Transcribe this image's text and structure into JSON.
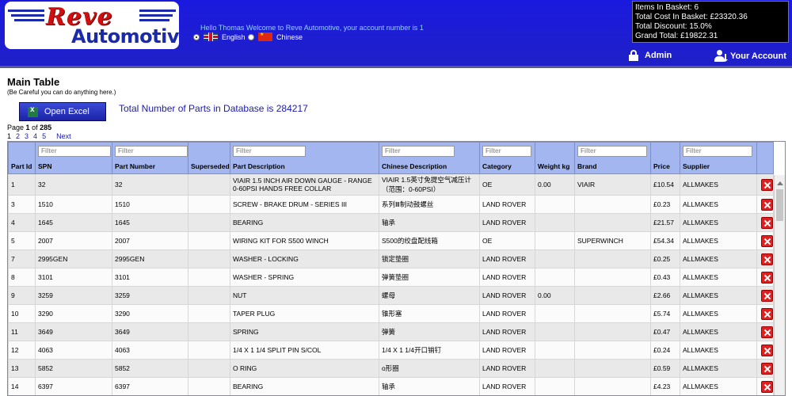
{
  "brand": {
    "line1": "Reve",
    "line2": "Automotive"
  },
  "header": {
    "welcome": "Hello Thomas Welcome to Reve Automotive, your account number is 1",
    "languages": [
      {
        "label": "English",
        "selected": true
      },
      {
        "label": "Chinese",
        "selected": false
      }
    ],
    "basket": {
      "items": "Items In Basket: 6",
      "cost": "Total Cost In Basket: £23320.36",
      "discount": "Total Discount: 15.0%",
      "grand": "Grand Total: £19822.31"
    },
    "admin_label": "Admin",
    "account_label": "Your Account"
  },
  "main": {
    "title": "Main Table",
    "warning": "(Be Careful you can do anything here.)",
    "excel_label": "Open Excel",
    "total_parts": "Total Number of Parts in Database is 284217",
    "page_word": "Page",
    "page_current": "1",
    "page_of": "of",
    "page_total": "285",
    "pages": [
      "1",
      "2",
      "3",
      "4",
      "5"
    ],
    "next": "Next"
  },
  "table": {
    "filter_placeholder": "Filter",
    "columns": [
      "Part Id",
      "SPN",
      "Part Number",
      "Superseded",
      "Part Description",
      "Chinese Description",
      "Category",
      "Weight kg",
      "Brand",
      "Price",
      "Supplier"
    ],
    "rows": [
      [
        "1",
        "32",
        "32",
        "",
        "VIAIR 1.5 INCH AIR DOWN GAUGE - RANGE 0-60PSI HANDS FREE COLLAR",
        "VIAIR 1.5英寸免提空气减压计（范围：0-60PSI）",
        "OE",
        "0.00",
        "VIAIR",
        "£10.54",
        "ALLMAKES"
      ],
      [
        "3",
        "1510",
        "1510",
        "",
        "SCREW - BRAKE DRUM - SERIES III",
        "系列Ⅲ制动鼓螺丝",
        "LAND ROVER",
        "",
        "",
        "£0.23",
        "ALLMAKES"
      ],
      [
        "4",
        "1645",
        "1645",
        "",
        "BEARING",
        "轴承",
        "LAND ROVER",
        "",
        "",
        "£21.57",
        "ALLMAKES"
      ],
      [
        "5",
        "2007",
        "2007",
        "",
        "WIRING KIT FOR S500 WINCH",
        "S500的绞盘配线箱",
        "OE",
        "",
        "SUPERWINCH",
        "£54.34",
        "ALLMAKES"
      ],
      [
        "7",
        "2995GEN",
        "2995GEN",
        "",
        "WASHER - LOCKING",
        "锁定垫圈",
        "LAND ROVER",
        "",
        "",
        "£0.25",
        "ALLMAKES"
      ],
      [
        "8",
        "3101",
        "3101",
        "",
        "WASHER - SPRING",
        "弹簧垫圈",
        "LAND ROVER",
        "",
        "",
        "£0.43",
        "ALLMAKES"
      ],
      [
        "9",
        "3259",
        "3259",
        "",
        "NUT",
        "螺母",
        "LAND ROVER",
        "0.00",
        "",
        "£2.66",
        "ALLMAKES"
      ],
      [
        "10",
        "3290",
        "3290",
        "",
        "TAPER PLUG",
        "锥形塞",
        "LAND ROVER",
        "",
        "",
        "£5.74",
        "ALLMAKES"
      ],
      [
        "11",
        "3649",
        "3649",
        "",
        "SPRING",
        "弹簧",
        "LAND ROVER",
        "",
        "",
        "£0.47",
        "ALLMAKES"
      ],
      [
        "12",
        "4063",
        "4063",
        "",
        "1/4 X 1 1/4 SPLIT PIN S/COL",
        "1/4 X 1 1/4开口销钉",
        "LAND ROVER",
        "",
        "",
        "£0.24",
        "ALLMAKES"
      ],
      [
        "13",
        "5852",
        "5852",
        "",
        "O RING",
        "o形圈",
        "LAND ROVER",
        "",
        "",
        "£0.59",
        "ALLMAKES"
      ],
      [
        "14",
        "6397",
        "6397",
        "",
        "BEARING",
        "轴承",
        "LAND ROVER",
        "",
        "",
        "£4.23",
        "ALLMAKES"
      ]
    ]
  }
}
